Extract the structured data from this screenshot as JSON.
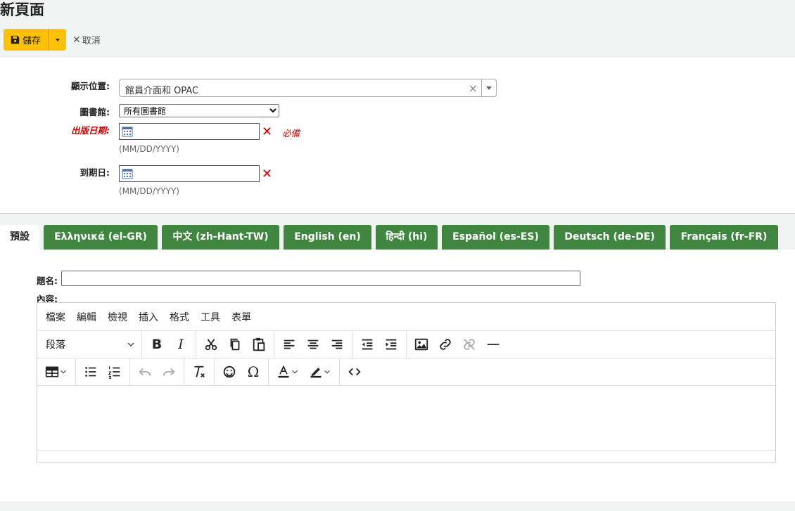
{
  "page": {
    "title": "新頁面"
  },
  "toolbar": {
    "save_label": "儲存",
    "cancel_label": "取消"
  },
  "form": {
    "display_location": {
      "label": "顯示位置:",
      "value": "館員介面和 OPAC"
    },
    "library": {
      "label": "圖書館:",
      "value": "所有圖書館"
    },
    "publication_date": {
      "label": "出版日期:",
      "value": "",
      "required_text": "必備",
      "hint": "(MM/DD/YYYY)"
    },
    "expiration_date": {
      "label": "到期日:",
      "value": "",
      "hint": "(MM/DD/YYYY)"
    }
  },
  "tabs": [
    {
      "label": "預設",
      "active": true
    },
    {
      "label": "Ελληνικά (el-GR)"
    },
    {
      "label": "中文 (zh-Hant-TW)"
    },
    {
      "label": "English (en)"
    },
    {
      "label": "हिन्दी (hi)"
    },
    {
      "label": "Español (es-ES)"
    },
    {
      "label": "Deutsch (de-DE)"
    },
    {
      "label": "Français (fr-FR)"
    }
  ],
  "content": {
    "title_label": "題名:",
    "title_value": "",
    "content_label": "內容:",
    "menubar": [
      "檔案",
      "編輯",
      "檢視",
      "插入",
      "格式",
      "工具",
      "表單"
    ],
    "format_select": "段落"
  },
  "colors": {
    "save_button": "#ffc107",
    "tab_bg": "#408540",
    "required": "#cc0000"
  }
}
